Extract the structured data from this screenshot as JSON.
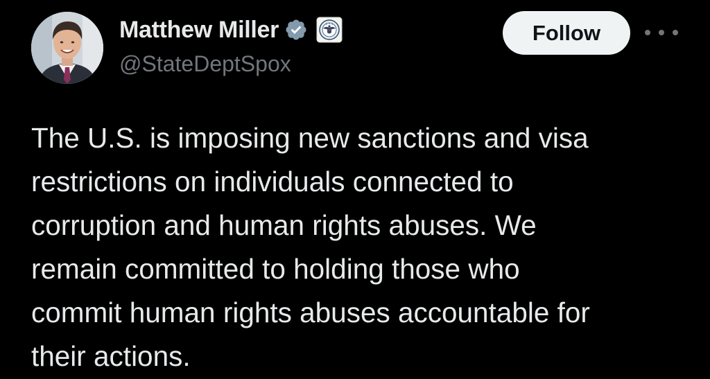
{
  "author": {
    "display_name": "Matthew Miller",
    "handle": "@StateDeptSpox",
    "verified_badge_icon": "verified-check-icon",
    "affiliation_badge_icon": "us-state-department-seal-icon",
    "verified_color": "#829aab"
  },
  "actions": {
    "follow_label": "Follow",
    "more_icon": "more-horizontal-icon"
  },
  "tweet": {
    "lines": [
      "The U.S. is imposing new sanctions and visa",
      "restrictions on individuals connected to",
      "corruption and human rights abuses. We",
      "remain committed to holding those who",
      "commit human rights abuses accountable for",
      "their actions."
    ]
  },
  "colors": {
    "background": "#000000",
    "primary_text": "#e7e9ea",
    "secondary_text": "#71767b",
    "follow_button_bg": "#eff3f4",
    "follow_button_text": "#0f1419"
  }
}
